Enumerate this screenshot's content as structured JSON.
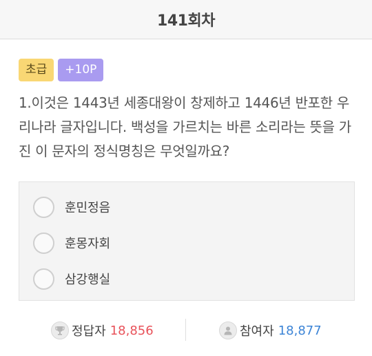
{
  "header": {
    "title": "141회차"
  },
  "badges": {
    "level": "초급",
    "points": "+10P"
  },
  "question": {
    "text": "1.이것은 1443년 세종대왕이 창제하고 1446년 반포한 우리나라 글자입니다. 백성을 가르치는 바른 소리라는 뜻을 가진 이 문자의 정식명칭은 무엇일까요?"
  },
  "options": [
    {
      "label": "훈민정음"
    },
    {
      "label": "훈몽자회"
    },
    {
      "label": "삼강행실"
    }
  ],
  "stats": {
    "correct_label": "정답자",
    "correct_value": "18,856",
    "participants_label": "참여자",
    "participants_value": "18,877"
  },
  "icons": {
    "correct": "trophy-icon",
    "participants": "person-icon"
  },
  "colors": {
    "level_badge": "#f9d774",
    "points_badge": "#a99bf0",
    "correct_value": "#e8525a",
    "participants_value": "#3c84d6"
  }
}
